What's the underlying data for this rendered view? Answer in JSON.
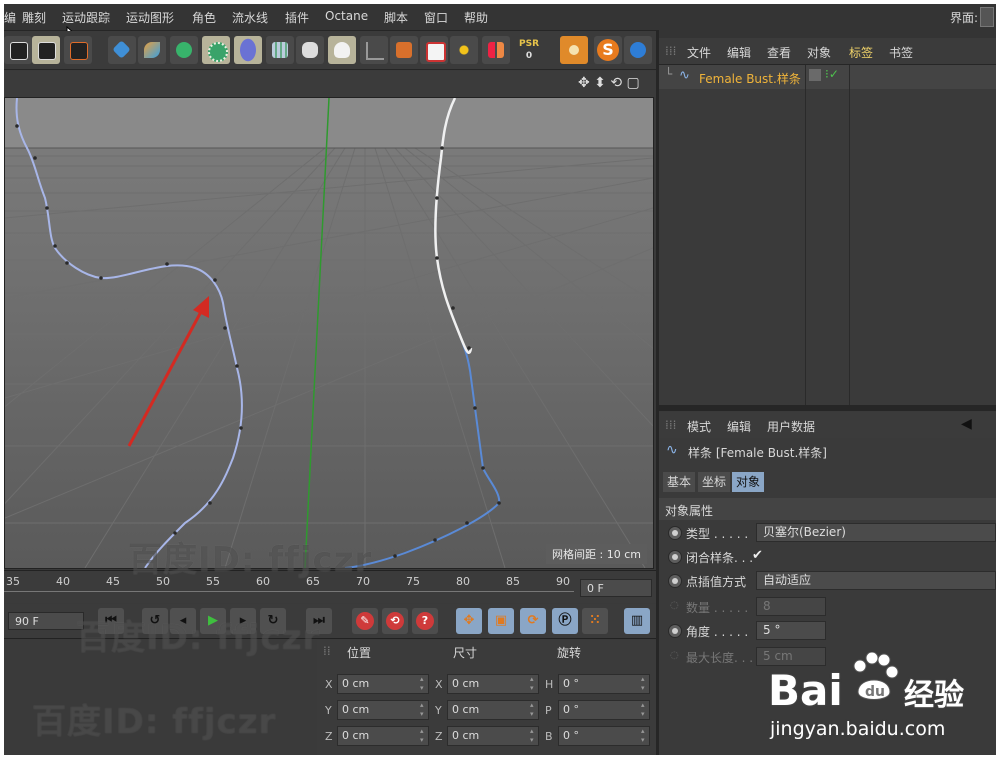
{
  "menu": [
    "雕刻",
    "运动跟踪",
    "运动图形",
    "角色",
    "流水线",
    "插件",
    "Octane",
    "脚本",
    "窗口",
    "帮助"
  ],
  "menu_partial_left": "编",
  "layout_label": "界面:",
  "toolbar": {
    "psr_label": "PSR",
    "psr_value": "0"
  },
  "viewport": {
    "grid_spacing": "网格间距 : 10 cm"
  },
  "timeline": {
    "ticks": [
      "35",
      "40",
      "45",
      "50",
      "55",
      "60",
      "65",
      "70",
      "75",
      "80",
      "85",
      "90"
    ],
    "current_frame": "0 F",
    "end_frame": "90 F"
  },
  "coords": {
    "headers": {
      "position": "位置",
      "size": "尺寸",
      "rotation": "旋转"
    },
    "rows": [
      {
        "axis": "X",
        "pos": "0 cm",
        "size_axis": "X",
        "size": "0 cm",
        "rot_axis": "H",
        "rot": "0 °"
      },
      {
        "axis": "Y",
        "pos": "0 cm",
        "size_axis": "Y",
        "size": "0 cm",
        "rot_axis": "P",
        "rot": "0 °"
      },
      {
        "axis": "Z",
        "pos": "0 cm",
        "size_axis": "Z",
        "size": "0 cm",
        "rot_axis": "B",
        "rot": "0 °"
      }
    ]
  },
  "object_manager": {
    "tabs": [
      "文件",
      "编辑",
      "查看",
      "对象",
      "标签",
      "书签"
    ],
    "object_name": "Female Bust.样条"
  },
  "attributes": {
    "tabs": [
      "模式",
      "编辑",
      "用户数据"
    ],
    "title": "样条 [Female Bust.样条]",
    "subtabs": [
      "基本",
      "坐标",
      "对象"
    ],
    "section": "对象属性",
    "rows": [
      {
        "label": "类型 . . . . .",
        "value": "贝塞尔(Bezier)",
        "dim": false
      },
      {
        "label": "闭合样条. . .",
        "value": "✔",
        "dim": false
      },
      {
        "label": "点插值方式",
        "value": "自动适应",
        "dim": false
      },
      {
        "label": "数量 . . . . .",
        "value": "8",
        "dim": true
      },
      {
        "label": "角度 . . . . .",
        "value": "5 °",
        "dim": false
      },
      {
        "label": "最大长度. . .",
        "value": "5 cm",
        "dim": true
      }
    ]
  },
  "watermark": {
    "text": "百度ID: ffjczr",
    "brand": "Bai",
    "brand2": "经验",
    "url": "jingyan.baidu.com"
  },
  "colors": {
    "spline": "#a8b6e8",
    "arrow": "#d32a22",
    "axis_green": "#2f9a2f",
    "accent": "#8aa6c6"
  }
}
